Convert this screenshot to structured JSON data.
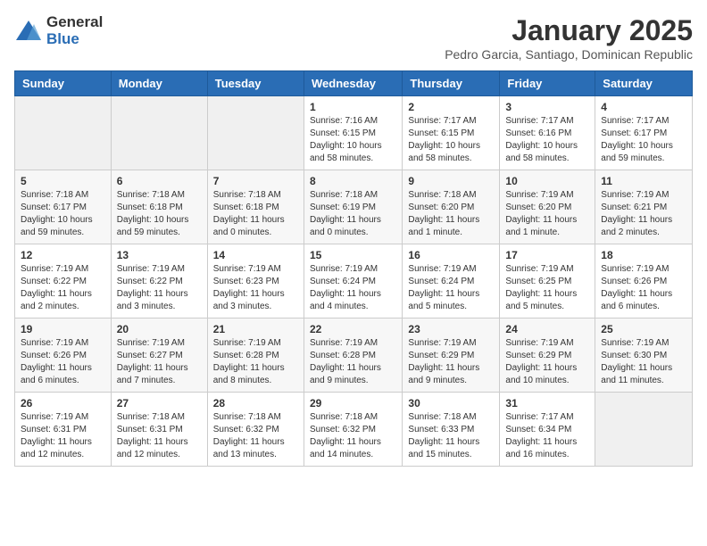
{
  "logo": {
    "general": "General",
    "blue": "Blue"
  },
  "header": {
    "month_year": "January 2025",
    "location": "Pedro Garcia, Santiago, Dominican Republic"
  },
  "days_of_week": [
    "Sunday",
    "Monday",
    "Tuesday",
    "Wednesday",
    "Thursday",
    "Friday",
    "Saturday"
  ],
  "weeks": [
    [
      {
        "day": "",
        "info": ""
      },
      {
        "day": "",
        "info": ""
      },
      {
        "day": "",
        "info": ""
      },
      {
        "day": "1",
        "info": "Sunrise: 7:16 AM\nSunset: 6:15 PM\nDaylight: 10 hours and 58 minutes."
      },
      {
        "day": "2",
        "info": "Sunrise: 7:17 AM\nSunset: 6:15 PM\nDaylight: 10 hours and 58 minutes."
      },
      {
        "day": "3",
        "info": "Sunrise: 7:17 AM\nSunset: 6:16 PM\nDaylight: 10 hours and 58 minutes."
      },
      {
        "day": "4",
        "info": "Sunrise: 7:17 AM\nSunset: 6:17 PM\nDaylight: 10 hours and 59 minutes."
      }
    ],
    [
      {
        "day": "5",
        "info": "Sunrise: 7:18 AM\nSunset: 6:17 PM\nDaylight: 10 hours and 59 minutes."
      },
      {
        "day": "6",
        "info": "Sunrise: 7:18 AM\nSunset: 6:18 PM\nDaylight: 10 hours and 59 minutes."
      },
      {
        "day": "7",
        "info": "Sunrise: 7:18 AM\nSunset: 6:18 PM\nDaylight: 11 hours and 0 minutes."
      },
      {
        "day": "8",
        "info": "Sunrise: 7:18 AM\nSunset: 6:19 PM\nDaylight: 11 hours and 0 minutes."
      },
      {
        "day": "9",
        "info": "Sunrise: 7:18 AM\nSunset: 6:20 PM\nDaylight: 11 hours and 1 minute."
      },
      {
        "day": "10",
        "info": "Sunrise: 7:19 AM\nSunset: 6:20 PM\nDaylight: 11 hours and 1 minute."
      },
      {
        "day": "11",
        "info": "Sunrise: 7:19 AM\nSunset: 6:21 PM\nDaylight: 11 hours and 2 minutes."
      }
    ],
    [
      {
        "day": "12",
        "info": "Sunrise: 7:19 AM\nSunset: 6:22 PM\nDaylight: 11 hours and 2 minutes."
      },
      {
        "day": "13",
        "info": "Sunrise: 7:19 AM\nSunset: 6:22 PM\nDaylight: 11 hours and 3 minutes."
      },
      {
        "day": "14",
        "info": "Sunrise: 7:19 AM\nSunset: 6:23 PM\nDaylight: 11 hours and 3 minutes."
      },
      {
        "day": "15",
        "info": "Sunrise: 7:19 AM\nSunset: 6:24 PM\nDaylight: 11 hours and 4 minutes."
      },
      {
        "day": "16",
        "info": "Sunrise: 7:19 AM\nSunset: 6:24 PM\nDaylight: 11 hours and 5 minutes."
      },
      {
        "day": "17",
        "info": "Sunrise: 7:19 AM\nSunset: 6:25 PM\nDaylight: 11 hours and 5 minutes."
      },
      {
        "day": "18",
        "info": "Sunrise: 7:19 AM\nSunset: 6:26 PM\nDaylight: 11 hours and 6 minutes."
      }
    ],
    [
      {
        "day": "19",
        "info": "Sunrise: 7:19 AM\nSunset: 6:26 PM\nDaylight: 11 hours and 6 minutes."
      },
      {
        "day": "20",
        "info": "Sunrise: 7:19 AM\nSunset: 6:27 PM\nDaylight: 11 hours and 7 minutes."
      },
      {
        "day": "21",
        "info": "Sunrise: 7:19 AM\nSunset: 6:28 PM\nDaylight: 11 hours and 8 minutes."
      },
      {
        "day": "22",
        "info": "Sunrise: 7:19 AM\nSunset: 6:28 PM\nDaylight: 11 hours and 9 minutes."
      },
      {
        "day": "23",
        "info": "Sunrise: 7:19 AM\nSunset: 6:29 PM\nDaylight: 11 hours and 9 minutes."
      },
      {
        "day": "24",
        "info": "Sunrise: 7:19 AM\nSunset: 6:29 PM\nDaylight: 11 hours and 10 minutes."
      },
      {
        "day": "25",
        "info": "Sunrise: 7:19 AM\nSunset: 6:30 PM\nDaylight: 11 hours and 11 minutes."
      }
    ],
    [
      {
        "day": "26",
        "info": "Sunrise: 7:19 AM\nSunset: 6:31 PM\nDaylight: 11 hours and 12 minutes."
      },
      {
        "day": "27",
        "info": "Sunrise: 7:18 AM\nSunset: 6:31 PM\nDaylight: 11 hours and 12 minutes."
      },
      {
        "day": "28",
        "info": "Sunrise: 7:18 AM\nSunset: 6:32 PM\nDaylight: 11 hours and 13 minutes."
      },
      {
        "day": "29",
        "info": "Sunrise: 7:18 AM\nSunset: 6:32 PM\nDaylight: 11 hours and 14 minutes."
      },
      {
        "day": "30",
        "info": "Sunrise: 7:18 AM\nSunset: 6:33 PM\nDaylight: 11 hours and 15 minutes."
      },
      {
        "day": "31",
        "info": "Sunrise: 7:17 AM\nSunset: 6:34 PM\nDaylight: 11 hours and 16 minutes."
      },
      {
        "day": "",
        "info": ""
      }
    ]
  ]
}
